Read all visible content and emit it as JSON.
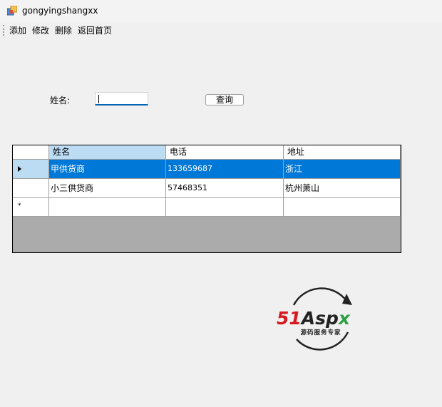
{
  "window": {
    "title": "gongyingshangxx"
  },
  "menu": {
    "items": [
      "添加",
      "修改",
      "删除",
      "返回首页"
    ]
  },
  "search": {
    "label": "姓名:",
    "value": "",
    "button": "查询"
  },
  "grid": {
    "columns": [
      "姓名",
      "电话",
      "地址"
    ],
    "rows": [
      [
        "甲供货商",
        "133659687",
        "浙江"
      ],
      [
        "小三供货商",
        "57468351",
        "杭州萧山"
      ]
    ],
    "new_row_marker": "*"
  },
  "logo": {
    "brand": "51Aspx",
    "tagline": "源码服务专家"
  },
  "colors": {
    "selection": "#0078d7",
    "header_selected": "#bcdcf4",
    "grid_background": "#ababab",
    "logo_red": "#d71920",
    "logo_green": "#2ea043"
  }
}
